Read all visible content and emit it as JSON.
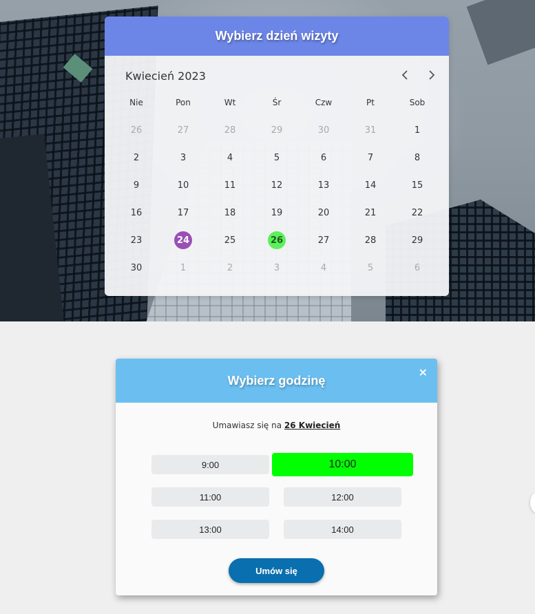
{
  "calendar": {
    "title": "Wybierz dzień wizyty",
    "month_label": "Kwiecień 2023",
    "prev_icon": "chevron-left-icon",
    "next_icon": "chevron-right-icon",
    "weekdays": [
      "Nie",
      "Pon",
      "Wt",
      "Śr",
      "Czw",
      "Pt",
      "Sob"
    ],
    "days": [
      {
        "label": "26",
        "muted": true
      },
      {
        "label": "27",
        "muted": true
      },
      {
        "label": "28",
        "muted": true
      },
      {
        "label": "29",
        "muted": true
      },
      {
        "label": "30",
        "muted": true
      },
      {
        "label": "31",
        "muted": true
      },
      {
        "label": "1"
      },
      {
        "label": "2"
      },
      {
        "label": "3"
      },
      {
        "label": "4"
      },
      {
        "label": "5"
      },
      {
        "label": "6"
      },
      {
        "label": "7"
      },
      {
        "label": "8"
      },
      {
        "label": "9"
      },
      {
        "label": "10"
      },
      {
        "label": "11"
      },
      {
        "label": "12"
      },
      {
        "label": "13"
      },
      {
        "label": "14"
      },
      {
        "label": "15"
      },
      {
        "label": "16"
      },
      {
        "label": "17"
      },
      {
        "label": "18"
      },
      {
        "label": "19"
      },
      {
        "label": "20"
      },
      {
        "label": "21"
      },
      {
        "label": "22"
      },
      {
        "label": "23"
      },
      {
        "label": "24",
        "state": "today"
      },
      {
        "label": "25"
      },
      {
        "label": "26",
        "state": "selected"
      },
      {
        "label": "27"
      },
      {
        "label": "28"
      },
      {
        "label": "29"
      },
      {
        "label": "30"
      },
      {
        "label": "1",
        "muted": true
      },
      {
        "label": "2",
        "muted": true
      },
      {
        "label": "3",
        "muted": true
      },
      {
        "label": "4",
        "muted": true
      },
      {
        "label": "5",
        "muted": true
      },
      {
        "label": "6",
        "muted": true
      }
    ]
  },
  "time_picker": {
    "title": "Wybierz godzinę",
    "close_label": "×",
    "booking_prefix": "Umawiasz się na",
    "booking_date": "26 Kwiecień",
    "slots": [
      {
        "label": "9:00"
      },
      {
        "label": "10:00",
        "selected": true
      },
      {
        "label": "11:00"
      },
      {
        "label": "12:00"
      },
      {
        "label": "13:00"
      },
      {
        "label": "14:00"
      }
    ],
    "submit_label": "Umów się"
  },
  "colors": {
    "calendar_header": "#6c86e8",
    "time_header": "#6bbff0",
    "today": "#9b4fb5",
    "selected_day": "#5cf05c",
    "selected_slot": "#00ff00",
    "submit": "#0a6fae"
  }
}
